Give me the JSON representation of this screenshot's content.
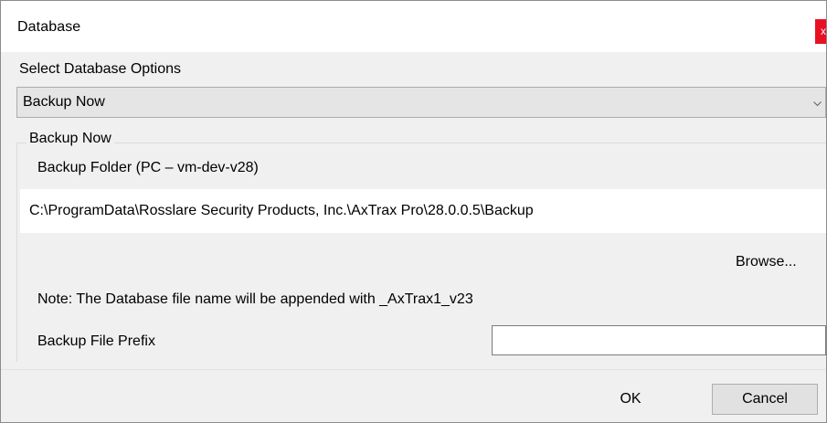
{
  "window": {
    "title": "Database",
    "close_label": "x"
  },
  "options": {
    "label": "Select Database Options",
    "selected": "Backup Now"
  },
  "group": {
    "title": "Backup Now",
    "folder_label": "Backup Folder (PC – vm-dev-v28)",
    "folder_path": "C:\\ProgramData\\Rosslare Security Products, Inc.\\AxTrax Pro\\28.0.0.5\\Backup",
    "browse_label": "Browse...",
    "note": "Note: The Database file name will be appended with  _AxTrax1_v23",
    "prefix_label": "Backup File Prefix",
    "prefix_value": ""
  },
  "buttons": {
    "ok": "OK",
    "cancel": "Cancel"
  },
  "colors": {
    "dialog_bg": "#f0f0f0",
    "close_red": "#e81123"
  },
  "icons": {
    "dropdown": "chevron-down-icon",
    "close": "close-icon"
  }
}
